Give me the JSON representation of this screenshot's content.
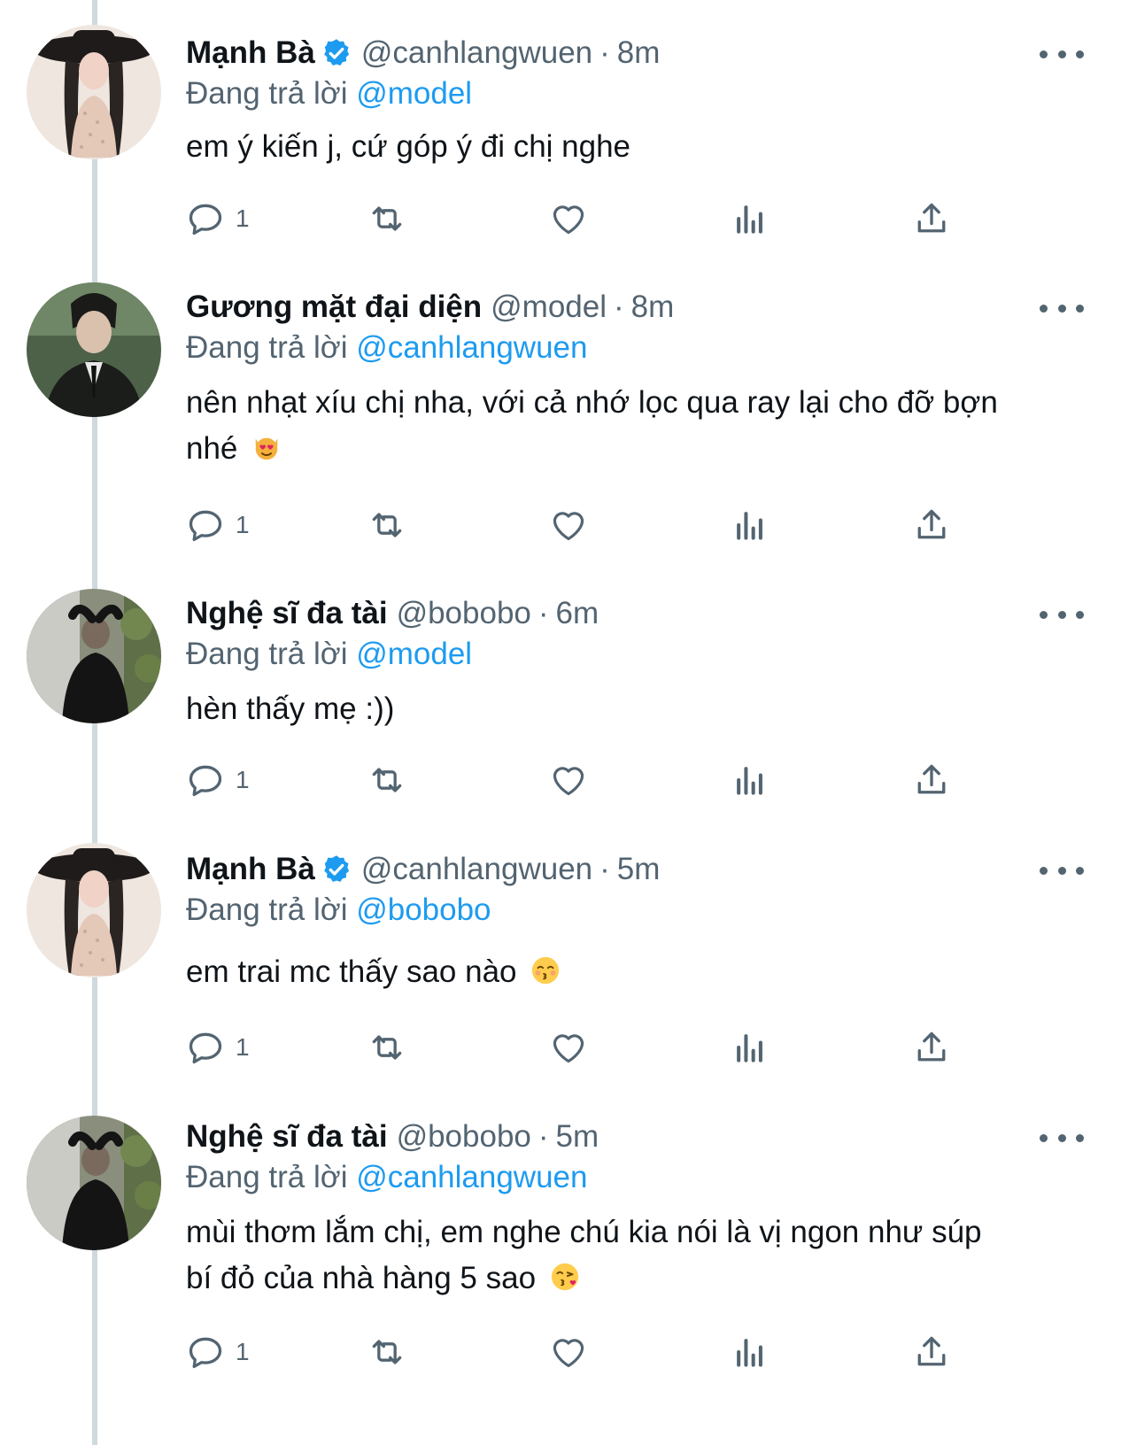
{
  "reply_prefix": "Đang trả lời",
  "colors": {
    "accent": "#1d9bf0",
    "muted": "#536471",
    "text": "#0f1419",
    "thread_line": "#cfd9de"
  },
  "tweets": [
    {
      "name": "Mạnh Bà",
      "verified": true,
      "handle": "@canhlangwuen",
      "separator": "·",
      "time": "8m",
      "reply_to": "@model",
      "text_lines": [
        "em ý kiến j, cứ góp ý đi chị nghe"
      ],
      "emoji": "",
      "reply_count": "1"
    },
    {
      "name": "Gương mặt đại diện",
      "verified": false,
      "handle": "@model",
      "separator": "·",
      "time": "8m",
      "reply_to": "@canhlangwuen",
      "text_lines": [
        "nên nhạt xíu chị nha, với cả nhớ lọc qua ray lại cho đỡ bợn",
        "nhé"
      ],
      "emoji": "heart-eyes-cat",
      "reply_count": "1"
    },
    {
      "name": "Nghệ sĩ đa tài",
      "verified": false,
      "handle": "@bobobo",
      "separator": "·",
      "time": "6m",
      "reply_to": "@model",
      "text_lines": [
        "hèn thấy mẹ :))"
      ],
      "emoji": "",
      "reply_count": "1"
    },
    {
      "name": "Mạnh Bà",
      "verified": true,
      "handle": "@canhlangwuen",
      "separator": "·",
      "time": "5m",
      "reply_to": "@bobobo",
      "text_lines": [
        "em trai mc thấy sao nào"
      ],
      "emoji": "kissing-smiling-eyes",
      "reply_count": "1"
    },
    {
      "name": "Nghệ sĩ đa tài",
      "verified": false,
      "handle": "@bobobo",
      "separator": "·",
      "time": "5m",
      "reply_to": "@canhlangwuen",
      "text_lines": [
        "mùi thơm lắm chị, em nghe chú kia nói là vị ngon như súp",
        "bí đỏ của nhà hàng 5 sao"
      ],
      "emoji": "face-blowing-kiss",
      "reply_count": "1"
    }
  ]
}
